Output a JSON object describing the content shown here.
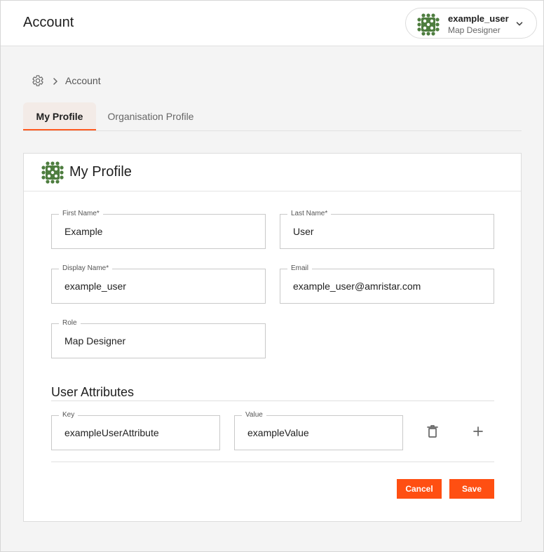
{
  "header": {
    "title": "Account",
    "user": {
      "name": "example_user",
      "role": "Map Designer"
    }
  },
  "breadcrumb": {
    "current": "Account"
  },
  "tabs": [
    {
      "label": "My Profile",
      "active": true
    },
    {
      "label": "Organisation Profile",
      "active": false
    }
  ],
  "profile": {
    "title": "My Profile",
    "fields": {
      "first_name": {
        "label": "First Name*",
        "value": "Example"
      },
      "last_name": {
        "label": "Last Name*",
        "value": "User"
      },
      "display_name": {
        "label": "Display Name*",
        "value": "example_user"
      },
      "email": {
        "label": "Email",
        "value": "example_user@amristar.com"
      },
      "role": {
        "label": "Role",
        "value": "Map Designer"
      }
    }
  },
  "attributes": {
    "title": "User Attributes",
    "key_label": "Key",
    "value_label": "Value",
    "rows": [
      {
        "key": "exampleUserAttribute",
        "value": "exampleValue"
      }
    ]
  },
  "actions": {
    "cancel": "Cancel",
    "save": "Save"
  },
  "icons": {
    "avatar": "avatar-icon",
    "settings": "gear-icon",
    "breadcrumb_separator": "chevron-right-icon",
    "dropdown": "chevron-down-icon",
    "delete": "trash-icon",
    "add": "plus-icon"
  },
  "colors": {
    "accent": "#ff4f12",
    "avatar": "#4e7d3f",
    "tab_active_bg": "#f3ebe7"
  }
}
